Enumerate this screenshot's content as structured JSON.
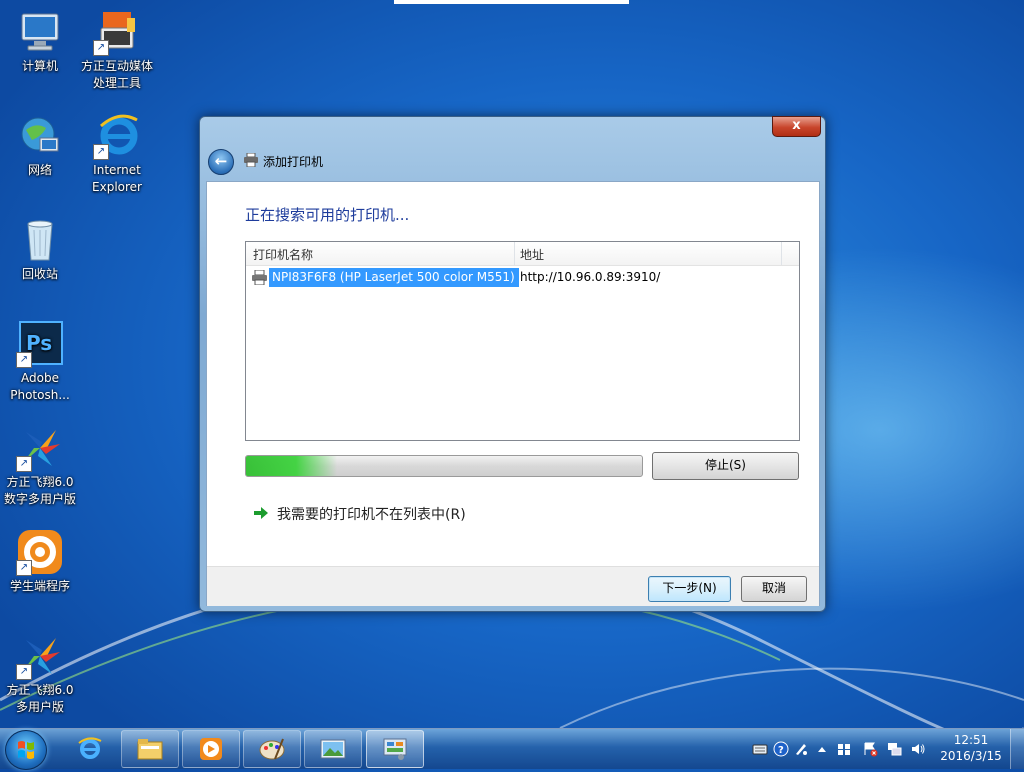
{
  "desktop": {
    "icons": [
      {
        "label": "计算机"
      },
      {
        "label": "方正互动媒体\n处理工具"
      },
      {
        "label": "网络"
      },
      {
        "label": "Internet\nExplorer"
      },
      {
        "label": "回收站"
      },
      {
        "label": "Adobe\nPhotosh..."
      },
      {
        "label": "方正飞翔6.0\n数字多用户版"
      },
      {
        "label": "学生端程序"
      },
      {
        "label": "方正飞翔6.0\n多用户版"
      }
    ],
    "shortcut_glyph": "↗"
  },
  "dialog": {
    "title": "添加打印机",
    "close_glyph": "x",
    "back_glyph": "←",
    "heading": "正在搜索可用的打印机...",
    "columns": {
      "name": "打印机名称",
      "address": "地址"
    },
    "printers": [
      {
        "name": "NPI83F6F8 (HP LaserJet 500 color M551)",
        "address": "http://10.96.0.89:3910/"
      }
    ],
    "progress_fraction": 0.23,
    "stop_label": "停止(S)",
    "not_listed_link": "我需要的打印机不在列表中(R)",
    "next_label": "下一步(N)",
    "cancel_label": "取消"
  },
  "taskbar": {
    "tray_icons": [
      "keyboard-icon",
      "help-icon",
      "pen-icon",
      "show-hidden-icon",
      "windows-flag-icon",
      "action-center-icon",
      "network-icon",
      "volume-icon"
    ],
    "clock_time": "12:51",
    "clock_date": "2016/3/15"
  },
  "colors": {
    "accent": "#3399ff",
    "heading": "#1e3c9c",
    "progress": "#2fbf2f",
    "close": "#c8452b"
  }
}
